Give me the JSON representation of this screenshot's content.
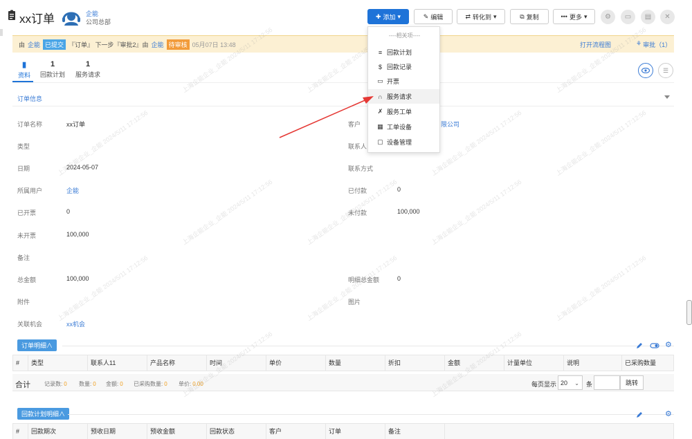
{
  "header": {
    "title": "xx订单",
    "owner": "企能",
    "dept": "公司总部",
    "buttons": {
      "add": "添加",
      "edit": "编辑",
      "convert": "转化到",
      "copy": "复制",
      "more": "更多"
    }
  },
  "approval": {
    "prefix": "由",
    "user1": "企能",
    "status1": "已提交",
    "middle": "『订单』 下一步『审批2』由",
    "user2": "企能",
    "status2": "待审核",
    "time": "05月07日 13:48",
    "flow_link": "打开流程图",
    "approve_link": "审批（1）"
  },
  "tabs": [
    {
      "count": "",
      "label": "资料"
    },
    {
      "count": "1",
      "label": "回款计划"
    },
    {
      "count": "1",
      "label": "服务请求"
    }
  ],
  "section_title": "订单信息",
  "fields_left": [
    {
      "label": "订单名称",
      "value": "xx订单"
    },
    {
      "label": "类型",
      "value": ""
    },
    {
      "label": "日期",
      "value": "2024-05-07"
    },
    {
      "label": "所属用户",
      "value": "企能"
    },
    {
      "label": "已开票",
      "value": "0"
    },
    {
      "label": "未开票",
      "value": "100,000"
    },
    {
      "label": "备注",
      "value": ""
    },
    {
      "label": "总金额",
      "value": "100,000"
    },
    {
      "label": "附件",
      "value": ""
    },
    {
      "label": "关联机会",
      "value": "xx机会"
    }
  ],
  "fields_right": [
    {
      "label": "客户",
      "value": "限公司"
    },
    {
      "label": "联系人",
      "value": ""
    },
    {
      "label": "联系方式",
      "value": ""
    },
    {
      "label": "已付款",
      "value": "0"
    },
    {
      "label": "未付款",
      "value": "100,000"
    },
    {
      "label": "明细总金额",
      "value": "0"
    },
    {
      "label": "图片",
      "value": ""
    }
  ],
  "order_detail": {
    "button": "订单明细∧",
    "columns": [
      "#",
      "类型",
      "联系人11",
      "产品名称",
      "时间",
      "单价",
      "数量",
      "折扣",
      "金额",
      "计量单位",
      "说明",
      "已采购数量"
    ],
    "summary_title": "合计",
    "summary": [
      {
        "label": "记录数:",
        "value": "0"
      },
      {
        "label": "数量:",
        "value": "0"
      },
      {
        "label": "金额:",
        "value": "0"
      },
      {
        "label": "已采购数量:",
        "value": "0"
      },
      {
        "label": "单价:",
        "value": "0.00"
      }
    ],
    "per_page_label": "每页显示",
    "per_page": "20",
    "unit": "条",
    "jump": "跳转"
  },
  "payment_plan": {
    "button": "回款计划明细∧",
    "columns": [
      "#",
      "回款期次",
      "预收日期",
      "预收金额",
      "回款状态",
      "客户",
      "订单",
      "备注"
    ]
  },
  "dropdown": {
    "header": "----相关项----",
    "items": [
      "回款计划",
      "回款记录",
      "开票",
      "服务请求",
      "服务工单",
      "工单设备",
      "设备管理"
    ]
  },
  "watermark": "上海企能企业_企能  2024/5/11 17:12:56",
  "colors": {
    "primary": "#1e73d8",
    "approval_bg": "#fcf0d3",
    "arrow": "#e53935"
  }
}
